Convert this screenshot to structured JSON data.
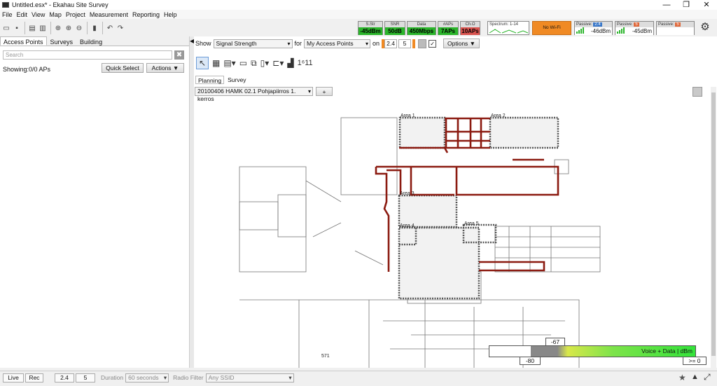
{
  "window": {
    "title": "Untitled.esx* - Ekahau Site Survey",
    "minimize": "—",
    "maximize": "❐",
    "close": "✕"
  },
  "menu": [
    "File",
    "Edit",
    "View",
    "Map",
    "Project",
    "Measurement",
    "Reporting",
    "Help"
  ],
  "stats": [
    {
      "label": "S.Str",
      "value": "-45dBm",
      "status": "green"
    },
    {
      "label": "SNR",
      "value": "50dB",
      "status": "green"
    },
    {
      "label": "Data",
      "value": "450Mbps",
      "status": "green"
    },
    {
      "label": "#APs",
      "value": "7APs",
      "status": "green"
    },
    {
      "label": "Ch.O",
      "value": "10APs",
      "status": "red"
    }
  ],
  "spectrum": {
    "label": "Spectrum: 1-14"
  },
  "wifi_status": "No Wi-Fi Association",
  "passive": [
    {
      "label": "Passive:",
      "band": "2.4",
      "band_color": "#3a78c9",
      "value": "-46dBm"
    },
    {
      "label": "Passive:",
      "band": "5",
      "band_color": "#e0683a",
      "value": "-45dBm"
    },
    {
      "label": "Passive:",
      "band": "5",
      "band_color": "#e0683a",
      "value": ""
    }
  ],
  "left": {
    "tabs": [
      "Access Points",
      "Surveys",
      "Building"
    ],
    "search_placeholder": "Search",
    "showing": "Showing:0/0 APs",
    "quick_select": "Quick Select",
    "actions": "Actions ▼"
  },
  "showbar": {
    "show_label": "Show",
    "visualization": "Signal Strength",
    "for_label": "for",
    "target": "My Access Points",
    "on_label": "on",
    "band1": "2.4",
    "band2": "5",
    "options": "Options ▼"
  },
  "view_tabs": [
    "Planning",
    "Survey"
  ],
  "floor": {
    "name": "20100406 HAMK 02.1 Pohjapiirros 1. kerros",
    "add": "+"
  },
  "map_labels": [
    "Area 1",
    "Area 2",
    "Area 3",
    "Area 4",
    "Area 5",
    "571"
  ],
  "legend": {
    "text": "Voice + Data | dBm",
    "marker": "-67",
    "min": "-80",
    "max": ">= 0"
  },
  "status": {
    "live": "Live",
    "rec": "Rec",
    "band1": "2.4",
    "band2": "5",
    "duration_label": "Duration",
    "duration": "60 seconds",
    "radio_label": "Radio Filter",
    "ssid": "Any SSID"
  }
}
